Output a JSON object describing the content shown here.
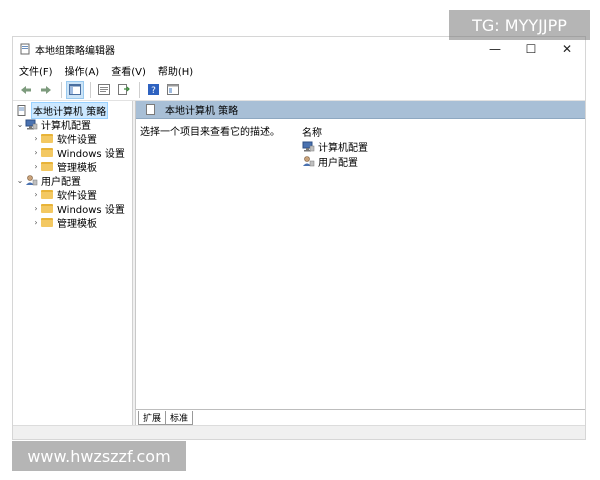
{
  "window": {
    "title": "本地组策略编辑器",
    "controls": {
      "minimize": "—",
      "maximize": "☐",
      "close": "✕"
    }
  },
  "menu": [
    {
      "label": "文件(F)"
    },
    {
      "label": "操作(A)"
    },
    {
      "label": "查看(V)"
    },
    {
      "label": "帮助(H)"
    }
  ],
  "toolbar": {
    "icons": [
      "back-icon",
      "forward-icon",
      "show-hide-tree-icon",
      "export-list-icon",
      "properties-icon",
      "help-icon",
      "view-icon"
    ]
  },
  "tree": {
    "root": "本地计算机 策略",
    "computer": {
      "label": "计算机配置",
      "children": [
        "软件设置",
        "Windows 设置",
        "管理模板"
      ]
    },
    "user": {
      "label": "用户配置",
      "children": [
        "软件设置",
        "Windows 设置",
        "管理模板"
      ]
    }
  },
  "right_pane": {
    "header": "本地计算机 策略",
    "description": "选择一个项目来查看它的描述。",
    "column_name": "名称",
    "items": [
      "计算机配置",
      "用户配置"
    ]
  },
  "tabs": [
    "扩展",
    "标准"
  ],
  "watermarks": {
    "top": "TG: MYYJJPP",
    "bottom": "www.hwzszzf.com"
  },
  "colors": {
    "header_bg": "#a8bfd6",
    "selection": "#cce8ff",
    "folder": "#f3c862"
  }
}
